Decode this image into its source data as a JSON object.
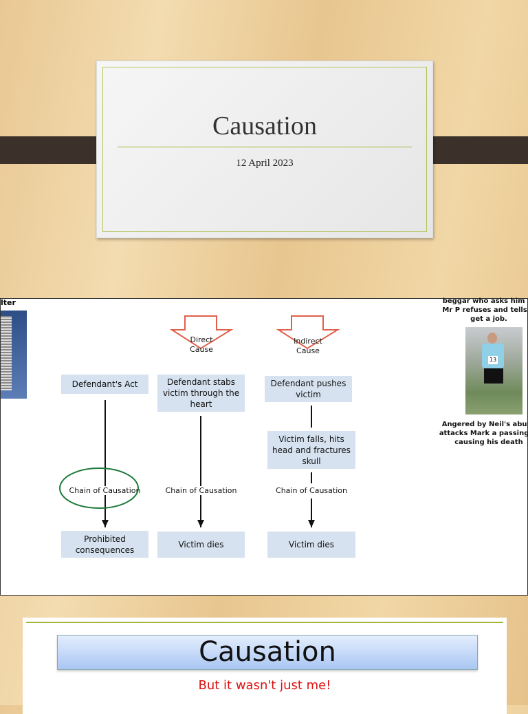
{
  "slide1": {
    "title": "Causation",
    "date": "12 April 2023"
  },
  "slide2": {
    "left_fragment": "lter",
    "arrows": [
      {
        "label_line1": "Direct",
        "label_line2": "Cause"
      },
      {
        "label_line1": "Indirect",
        "label_line2": "Cause"
      }
    ],
    "columns": [
      {
        "top": "Defendant's Act",
        "chain": "Chain of Causation",
        "bottom": "Prohibited consequences"
      },
      {
        "top": "Defendant stabs victim through the heart",
        "chain": "Chain of Causation",
        "bottom": "Victim dies"
      },
      {
        "top": "Defendant pushes victim",
        "middle": "Victim falls, hits head and fractures skull",
        "chain": "Chain of Causation",
        "bottom": "Victim dies"
      }
    ],
    "right_top_text": [
      "beggar who asks him fo",
      "Mr P refuses and tells D",
      "get a job."
    ],
    "right_bottom_text": [
      "Angered by Neil's abuse",
      "attacks Mark a passing jo",
      "causing his death"
    ],
    "bib_number": "13"
  },
  "slide3": {
    "title": "Causation",
    "subtitle": "But it wasn't just me!"
  },
  "colors": {
    "accent_green": "#a2b43a",
    "arrow_red": "#e0604a",
    "box_blue": "#d6e2ef",
    "subtitle_red": "#dd1111"
  }
}
